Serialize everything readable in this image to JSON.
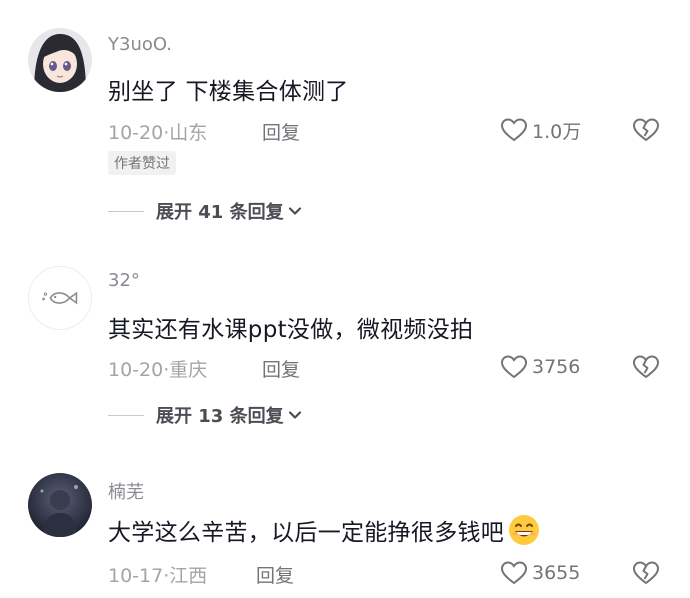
{
  "comments": [
    {
      "username": "Y3uoO.",
      "text": "别坐了 下楼集合体测了",
      "date": "10-20·山东",
      "reply": "回复",
      "likes": "1.0万",
      "badge": "作者赞过",
      "expand": "展开 41 条回复"
    },
    {
      "username": "32°",
      "text": "其实还有水课ppt没做，微视频没拍",
      "date": "10-20·重庆",
      "reply": "回复",
      "likes": "3756",
      "expand": "展开 13 条回复"
    },
    {
      "username": "楠芜",
      "text": "大学这么辛苦，以后一定能挣很多钱吧",
      "date": "10-17·江西",
      "reply": "回复",
      "likes": "3655"
    }
  ],
  "icons": {
    "like": "heart-outline-icon",
    "dislike": "broken-heart-icon",
    "expand": "chevron-down-icon",
    "emoji": "grinning-face-emoji"
  },
  "colors": {
    "primary_text": "#161823",
    "secondary_text": "#a3a4a8",
    "action_text": "#73747a"
  }
}
